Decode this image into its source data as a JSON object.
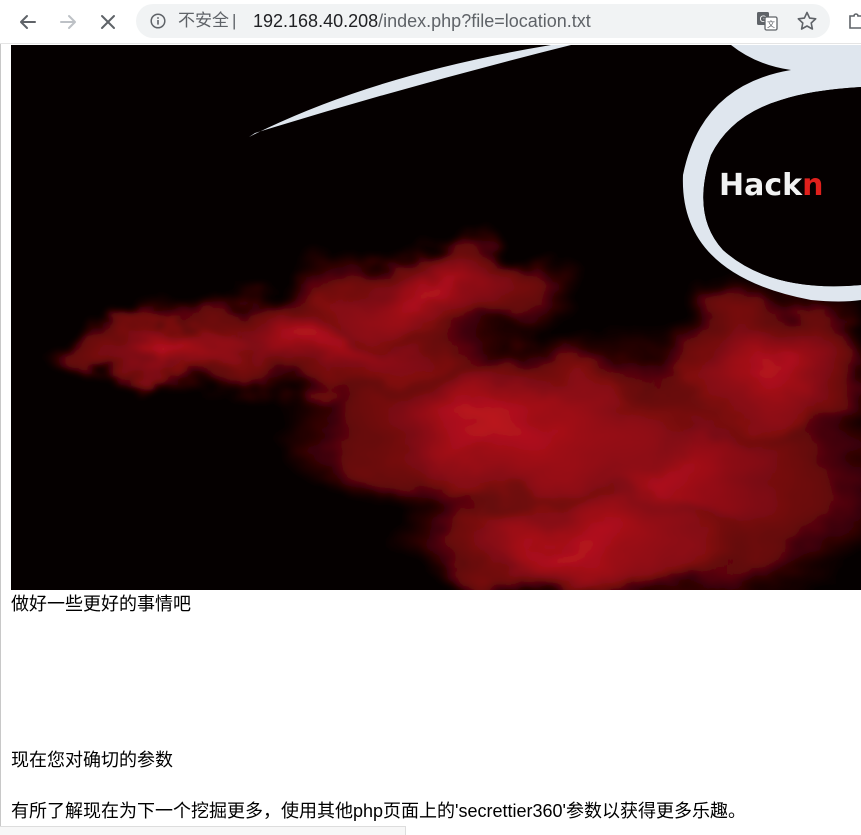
{
  "browser": {
    "security_label": "不安全",
    "separator": "|",
    "url_host": "192.168.40.208",
    "url_path": "/index.php?file=location.txt",
    "icons": {
      "back": "arrow-left-icon",
      "forward": "arrow-right-icon",
      "stop": "close-icon",
      "info": "info-icon",
      "translate": "translate-icon",
      "bookmark": "star-icon",
      "extension": "puzzle-icon"
    }
  },
  "page": {
    "banner": {
      "logo_text_white": "Hack",
      "logo_text_red": "n",
      "colors": {
        "background": "#050000",
        "smoke": "#b3111a",
        "logo_ring": "#dfe6ee",
        "logo_accent": "#e0201c"
      }
    },
    "line1": "做好一些更好的事情吧",
    "line2": "现在您对确切的参数",
    "line3": "有所了解现在为下一个挖掘更多，使用其他php页面上的'secrettier360'参数以获得更多乐趣。"
  }
}
